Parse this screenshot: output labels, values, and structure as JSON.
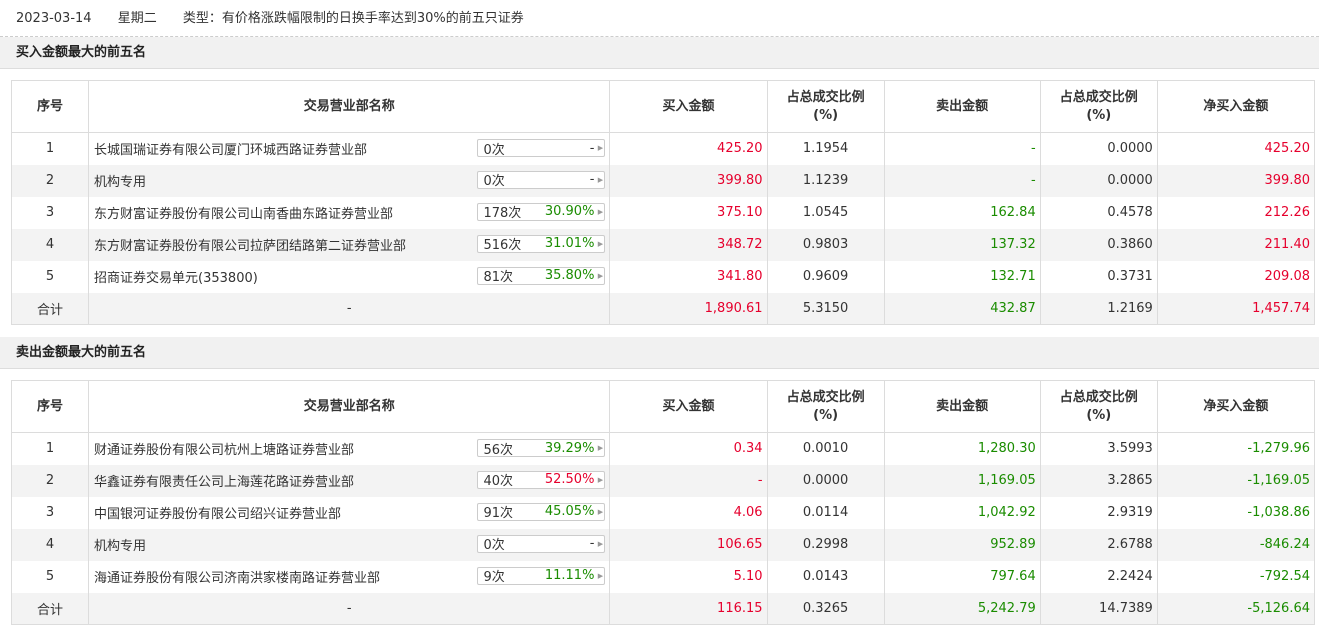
{
  "topbar": {
    "date": "2023-03-14",
    "weekday": "星期二",
    "type": "类型：有价格涨跌幅限制的日换手率达到30%的前五只证券"
  },
  "headers": [
    "序号",
    "交易营业部名称",
    "买入金额",
    "占总成交比例\n(%)",
    "卖出金额",
    "占总成交比例\n(%)",
    "净买入金额"
  ],
  "sections": [
    {
      "title": "买入金额最大的前五名",
      "rows": [
        {
          "seq": "1",
          "name": "长城国瑞证券有限公司厦门环城西路证券营业部",
          "times": "0次",
          "pct": "-",
          "pct_color": "dark",
          "buy": "425.20",
          "buy_color": "red",
          "buy_ratio": "1.1954",
          "sell": "-",
          "sell_color": "green",
          "sell_ratio": "0.0000",
          "net": "425.20",
          "net_color": "red"
        },
        {
          "seq": "2",
          "name": "机构专用",
          "times": "0次",
          "pct": "-",
          "pct_color": "dark",
          "buy": "399.80",
          "buy_color": "red",
          "buy_ratio": "1.1239",
          "sell": "-",
          "sell_color": "green",
          "sell_ratio": "0.0000",
          "net": "399.80",
          "net_color": "red"
        },
        {
          "seq": "3",
          "name": "东方财富证券股份有限公司山南香曲东路证券营业部",
          "times": "178次",
          "pct": "30.90%",
          "pct_color": "green",
          "buy": "375.10",
          "buy_color": "red",
          "buy_ratio": "1.0545",
          "sell": "162.84",
          "sell_color": "green",
          "sell_ratio": "0.4578",
          "net": "212.26",
          "net_color": "red"
        },
        {
          "seq": "4",
          "name": "东方财富证券股份有限公司拉萨团结路第二证券营业部",
          "times": "516次",
          "pct": "31.01%",
          "pct_color": "green",
          "buy": "348.72",
          "buy_color": "red",
          "buy_ratio": "0.9803",
          "sell": "137.32",
          "sell_color": "green",
          "sell_ratio": "0.3860",
          "net": "211.40",
          "net_color": "red"
        },
        {
          "seq": "5",
          "name": "招商证券交易单元(353800)",
          "times": "81次",
          "pct": "35.80%",
          "pct_color": "green",
          "buy": "341.80",
          "buy_color": "red",
          "buy_ratio": "0.9609",
          "sell": "132.71",
          "sell_color": "green",
          "sell_ratio": "0.3731",
          "net": "209.08",
          "net_color": "red"
        }
      ],
      "total": {
        "label": "合计",
        "name": "-",
        "buy": "1,890.61",
        "buy_color": "red",
        "buy_ratio": "5.3150",
        "sell": "432.87",
        "sell_color": "green",
        "sell_ratio": "1.2169",
        "net": "1,457.74",
        "net_color": "red"
      }
    },
    {
      "title": "卖出金额最大的前五名",
      "rows": [
        {
          "seq": "1",
          "name": "财通证券股份有限公司杭州上塘路证券营业部",
          "times": "56次",
          "pct": "39.29%",
          "pct_color": "green",
          "buy": "0.34",
          "buy_color": "red",
          "buy_ratio": "0.0010",
          "sell": "1,280.30",
          "sell_color": "green",
          "sell_ratio": "3.5993",
          "net": "-1,279.96",
          "net_color": "green"
        },
        {
          "seq": "2",
          "name": "华鑫证券有限责任公司上海莲花路证券营业部",
          "times": "40次",
          "pct": "52.50%",
          "pct_color": "red",
          "buy": "-",
          "buy_color": "red",
          "buy_ratio": "0.0000",
          "sell": "1,169.05",
          "sell_color": "green",
          "sell_ratio": "3.2865",
          "net": "-1,169.05",
          "net_color": "green"
        },
        {
          "seq": "3",
          "name": "中国银河证券股份有限公司绍兴证券营业部",
          "times": "91次",
          "pct": "45.05%",
          "pct_color": "green",
          "buy": "4.06",
          "buy_color": "red",
          "buy_ratio": "0.0114",
          "sell": "1,042.92",
          "sell_color": "green",
          "sell_ratio": "2.9319",
          "net": "-1,038.86",
          "net_color": "green"
        },
        {
          "seq": "4",
          "name": "机构专用",
          "times": "0次",
          "pct": "-",
          "pct_color": "dark",
          "buy": "106.65",
          "buy_color": "red",
          "buy_ratio": "0.2998",
          "sell": "952.89",
          "sell_color": "green",
          "sell_ratio": "2.6788",
          "net": "-846.24",
          "net_color": "green"
        },
        {
          "seq": "5",
          "name": "海通证券股份有限公司济南洪家楼南路证券营业部",
          "times": "9次",
          "pct": "11.11%",
          "pct_color": "green",
          "buy": "5.10",
          "buy_color": "red",
          "buy_ratio": "0.0143",
          "sell": "797.64",
          "sell_color": "green",
          "sell_ratio": "2.2424",
          "net": "-792.54",
          "net_color": "green"
        }
      ],
      "total": {
        "label": "合计",
        "name": "-",
        "buy": "116.15",
        "buy_color": "red",
        "buy_ratio": "0.3265",
        "sell": "5,242.79",
        "sell_color": "green",
        "sell_ratio": "14.7389",
        "net": "-5,126.64",
        "net_color": "green"
      }
    }
  ]
}
